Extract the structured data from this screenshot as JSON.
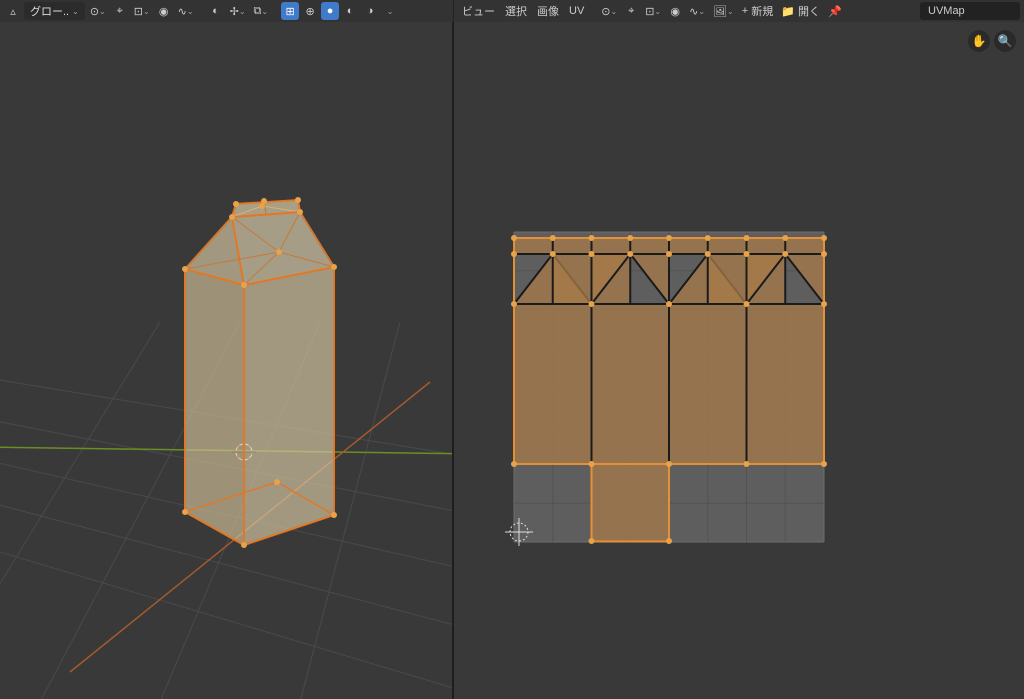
{
  "left_header": {
    "orientation": "グロー..",
    "pivot_icon": "median-point-icon",
    "snap_icon": "snap-icon",
    "snap_target": "increment-icon",
    "proportional": "proportional-edit-icon",
    "curve": "smooth-curve-icon"
  },
  "left_header2": {
    "show_gizmo": "gizmo-icon",
    "overlay_icon": "overlay-icon",
    "xray_icon": "toggle-xray-icon",
    "shading_group": [
      "wireframe-shading",
      "solid-shading",
      "material-preview",
      "rendered-shading"
    ]
  },
  "right_header": {
    "view_label": "ビュー",
    "select_label": "選択",
    "image_label": "画像",
    "uv_label": "UV",
    "new_label": "新規",
    "open_label": "開く",
    "uvmap_name": "UVMap"
  },
  "icons": {
    "hand": "✋",
    "zoom": "🔍",
    "plus": "+",
    "folder": "📁",
    "pin": "📌",
    "chev": "⌄"
  }
}
